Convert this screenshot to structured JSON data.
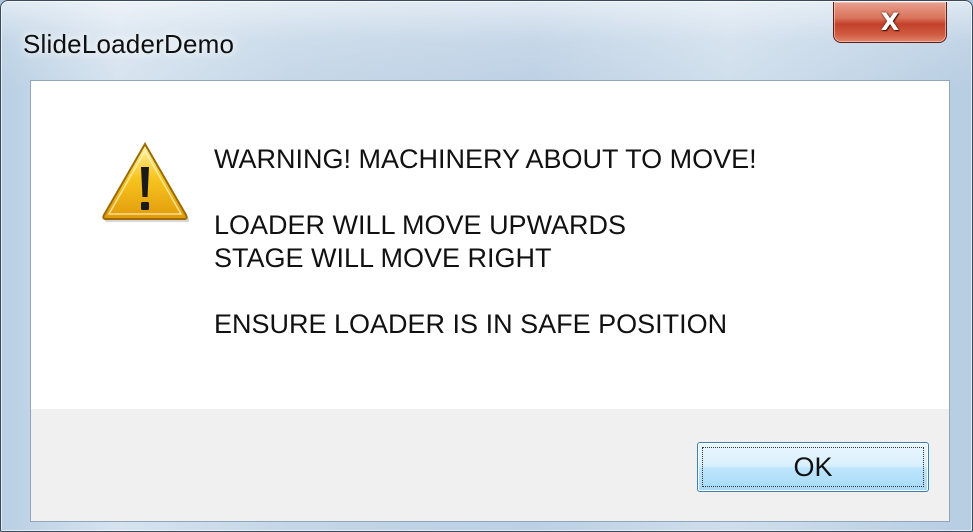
{
  "window": {
    "title": "SlideLoaderDemo",
    "close_icon": "close-icon",
    "close_glyph": "X"
  },
  "dialog": {
    "icon": "warning-icon",
    "message_lines": [
      "WARNING! MACHINERY ABOUT TO MOVE!",
      "LOADER WILL MOVE UPWARDS",
      "STAGE WILL MOVE RIGHT",
      "ENSURE LOADER IS IN SAFE POSITION"
    ],
    "ok_label": "OK"
  },
  "colors": {
    "close_button": "#c3412a",
    "warning_fill": "#f7c51f",
    "ok_button_border": "#3c7fb1"
  }
}
